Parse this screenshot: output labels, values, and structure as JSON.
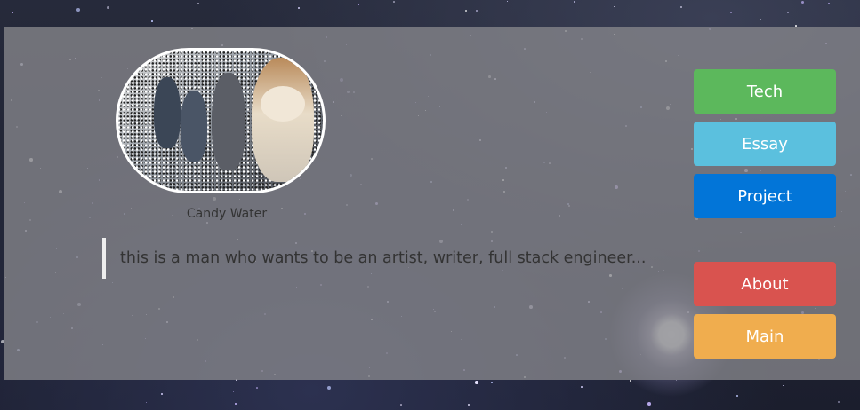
{
  "profile": {
    "name": "Candy Water",
    "tagline": "this is a man who wants to be an artist, writer, full stack engineer..."
  },
  "nav": {
    "tech": "Tech",
    "essay": "Essay",
    "project": "Project",
    "about": "About",
    "main": "Main"
  },
  "colors": {
    "tech": "#5cb85c",
    "essay": "#5bc0de",
    "project": "#0275d8",
    "about": "#d9534f",
    "main": "#f0ad4e"
  }
}
